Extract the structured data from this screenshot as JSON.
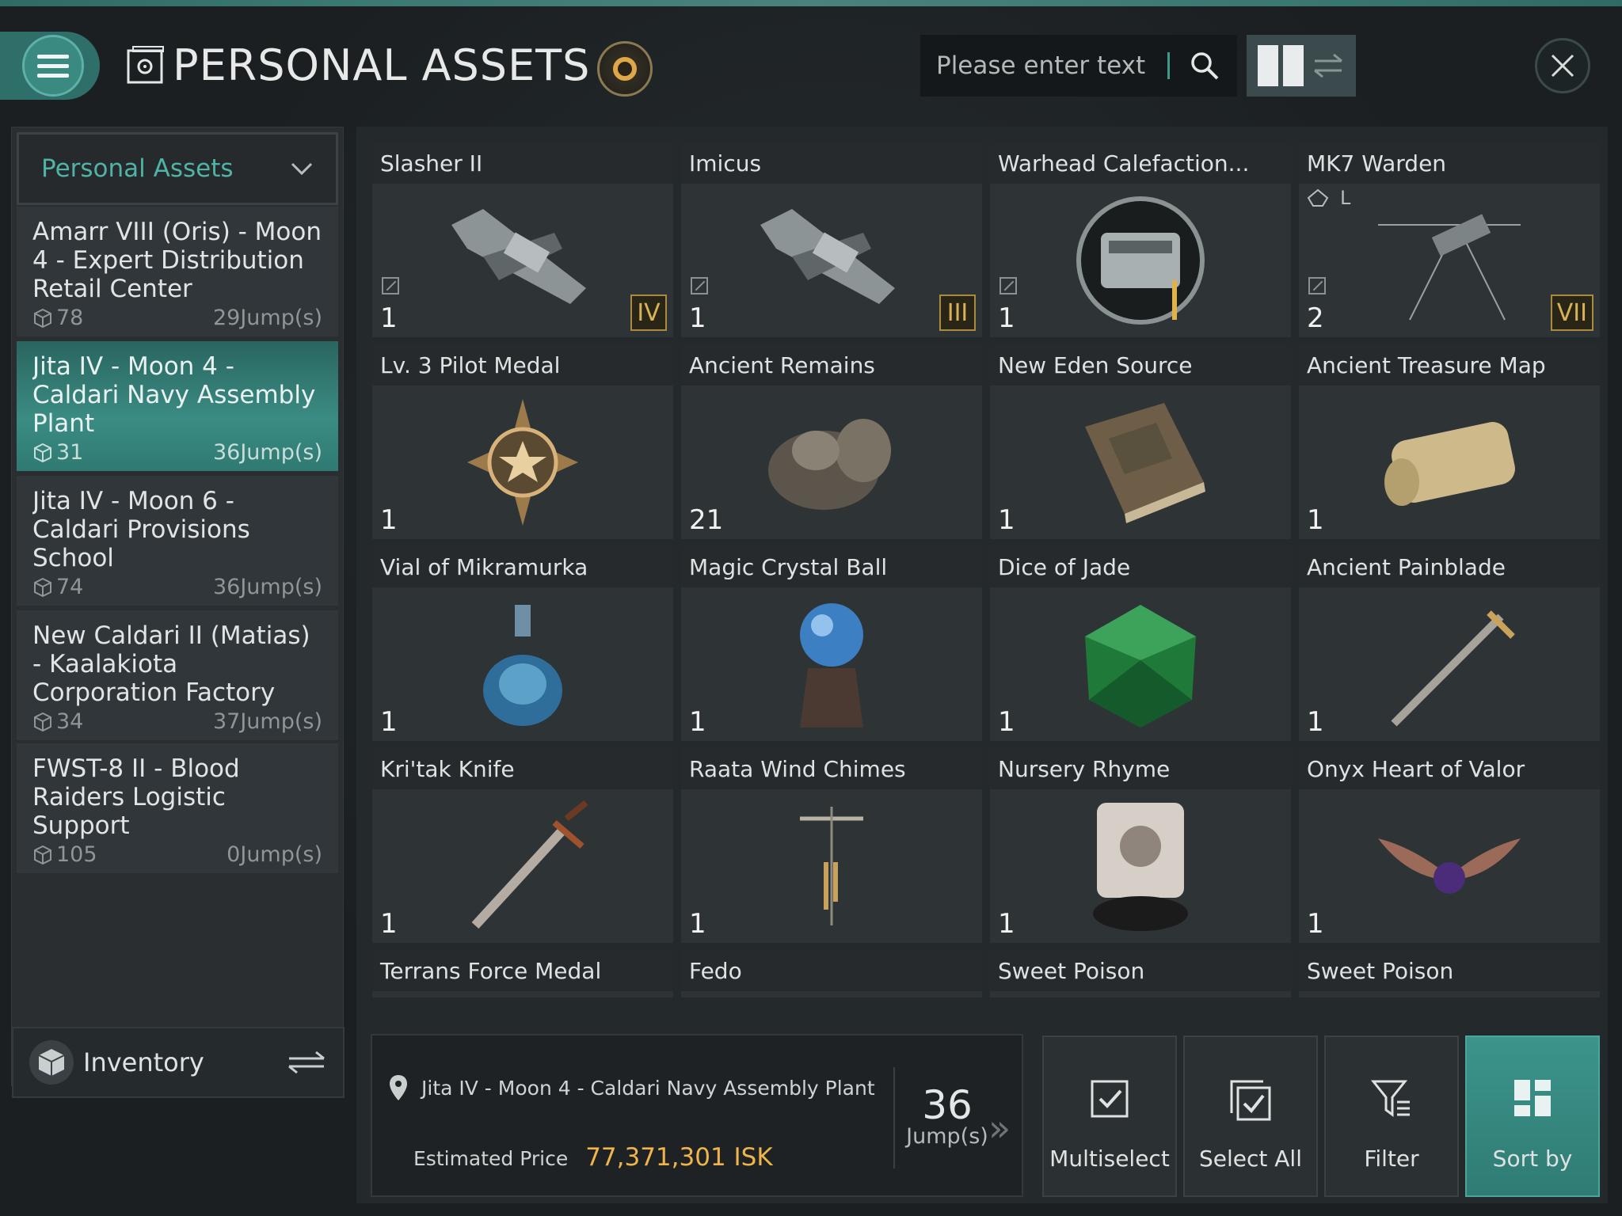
{
  "header": {
    "title": "PERSONAL ASSETS",
    "search_placeholder": "Please enter text"
  },
  "sidebar": {
    "dropdown_label": "Personal Assets",
    "locations": [
      {
        "name": "Amarr VIII (Oris) - Moon 4 - Expert Distribution Retail Center",
        "count": "78",
        "jumps": "29Jump(s)",
        "active": false
      },
      {
        "name": "Jita IV - Moon 4 - Caldari Navy Assembly Plant",
        "count": "31",
        "jumps": "36Jump(s)",
        "active": true
      },
      {
        "name": "Jita IV - Moon 6 - Caldari Provisions School",
        "count": "74",
        "jumps": "36Jump(s)",
        "active": false
      },
      {
        "name": "New Caldari II (Matias) - Kaalakiota Corporation Factory",
        "count": "34",
        "jumps": "37Jump(s)",
        "active": false
      },
      {
        "name": "FWST-8 II - Blood Raiders Logistic Support",
        "count": "105",
        "jumps": "0Jump(s)",
        "active": false
      }
    ],
    "inventory_label": "Inventory"
  },
  "items": [
    {
      "name": "Slasher II",
      "qty": "1",
      "tier": "IV",
      "icon": "frigate-ship-icon"
    },
    {
      "name": "Imicus",
      "qty": "1",
      "tier": "III",
      "icon": "frigate-ship-icon"
    },
    {
      "name": "Warhead Calefaction...",
      "qty": "1",
      "tier": "",
      "icon": "warhead-module-icon"
    },
    {
      "name": "MK7 Warden",
      "qty": "2",
      "tier": "VII",
      "size": "L",
      "icon": "drone-icon"
    },
    {
      "name": "Lv. 3 Pilot Medal",
      "qty": "1",
      "tier": "",
      "icon": "medal-icon"
    },
    {
      "name": "Ancient Remains",
      "qty": "21",
      "tier": "",
      "icon": "remains-icon"
    },
    {
      "name": "New Eden Source",
      "qty": "1",
      "tier": "",
      "icon": "book-icon"
    },
    {
      "name": "Ancient Treasure Map",
      "qty": "1",
      "tier": "",
      "icon": "scroll-map-icon"
    },
    {
      "name": "Vial of Mikramurka",
      "qty": "1",
      "tier": "",
      "icon": "vial-icon"
    },
    {
      "name": "Magic Crystal Ball",
      "qty": "1",
      "tier": "",
      "icon": "crystal-ball-icon"
    },
    {
      "name": "Dice of Jade",
      "qty": "1",
      "tier": "",
      "icon": "dice-icon"
    },
    {
      "name": "Ancient Painblade",
      "qty": "1",
      "tier": "",
      "icon": "blade-icon"
    },
    {
      "name": "Kri'tak Knife",
      "qty": "1",
      "tier": "",
      "icon": "knife-icon"
    },
    {
      "name": "Raata Wind Chimes",
      "qty": "1",
      "tier": "",
      "icon": "wind-chimes-icon"
    },
    {
      "name": "Nursery Rhyme",
      "qty": "1",
      "tier": "",
      "icon": "record-icon"
    },
    {
      "name": "Onyx Heart of Valor",
      "qty": "1",
      "tier": "",
      "icon": "winged-heart-icon"
    },
    {
      "name": "Terrans Force Medal",
      "qty": "",
      "tier": "",
      "icon": ""
    },
    {
      "name": "Fedo",
      "qty": "",
      "tier": "",
      "icon": ""
    },
    {
      "name": "Sweet Poison",
      "qty": "",
      "tier": "",
      "icon": ""
    },
    {
      "name": "Sweet Poison",
      "qty": "",
      "tier": "",
      "icon": ""
    }
  ],
  "footer": {
    "location": "Jita IV - Moon 4 - Caldari Navy Assembly Plant",
    "price_label": "Estimated Price",
    "price_value": "77,371,301 ISK",
    "jumps_value": "36",
    "jumps_unit": "Jump(s)",
    "buttons": {
      "multiselect": "Multiselect",
      "select_all": "Select All",
      "filter": "Filter",
      "sort_by": "Sort by"
    }
  },
  "colors": {
    "accent": "#3c948a",
    "price": "#f0b44a",
    "tier": "#d8b257"
  }
}
